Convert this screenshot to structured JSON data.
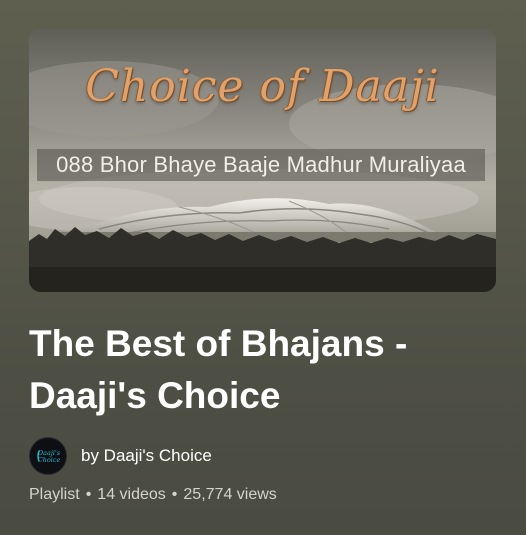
{
  "thumbnail": {
    "script_text": "Choice of Daaji",
    "caption": "088 Bhor Bhaye Baaje Madhur Muraliyaa"
  },
  "playlist": {
    "title": "The Best of Bhajans - Daaji's Choice"
  },
  "channel": {
    "byline": "by Daaji's Choice",
    "avatar_text_line1": "Daaji's",
    "avatar_text_line2": "Choice"
  },
  "meta": {
    "type": "Playlist",
    "video_count": "14 videos",
    "views": "25,774 views",
    "separator": "•"
  },
  "colors": {
    "background": "#56574a",
    "title": "#ffffff",
    "meta": "#d4d3cc",
    "script": "#e0a26a",
    "avatar_accent": "#2bb6c9"
  }
}
